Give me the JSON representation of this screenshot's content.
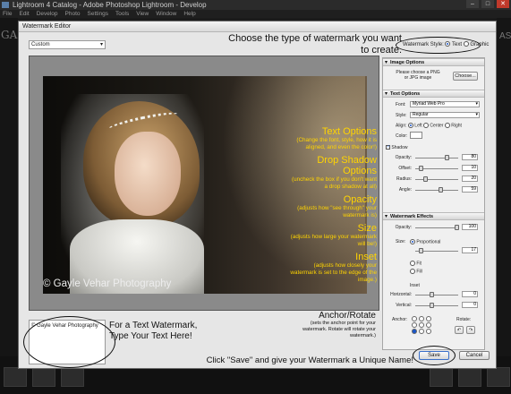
{
  "app": {
    "title": "Lightroom 4 Catalog - Adobe Photoshop Lightroom - Develop",
    "menu": [
      "File",
      "Edit",
      "Develop",
      "Photo",
      "Settings",
      "Tools",
      "View",
      "Window",
      "Help"
    ],
    "left_letters": "GA",
    "right_letters": "AS"
  },
  "dialog": {
    "title": "Watermark Editor",
    "preset": "Custom",
    "callout_style": "Choose the type of watermark you want to create.",
    "style_label": "Watermark Style:",
    "style_options": [
      "Text",
      "Graphic"
    ],
    "style_selected": "Text",
    "watermark_text": "© Gayle Vehar Photography",
    "text_area_value": "© Gayle Vehar Photography",
    "callout_text": "For a Text Watermark, Type Your Text Here!",
    "callout_save": "Click \"Save\" and give your Watermark a Unique Name!",
    "save_label": "Save",
    "cancel_label": "Cancel"
  },
  "annotations": [
    {
      "heading": "Text Options",
      "desc": "(Change the font, style, how it is aligned, and even the color!)"
    },
    {
      "heading": "Drop Shadow Options",
      "desc": "(uncheck the box if you don't want a drop shadow at all)"
    },
    {
      "heading": "Opacity",
      "desc": "(adjusts how \"see through\" your watermark is)"
    },
    {
      "heading": "Size",
      "desc": "(adjusts how large your watermark will be!)"
    },
    {
      "heading": "Inset",
      "desc": "(adjusts how closely your watermark is set to the edge of the image.)"
    },
    {
      "heading": "Anchor/Rotate",
      "desc": "(sets the anchor point for your watermark. Rotate will rotate your watermark.)"
    }
  ],
  "panel": {
    "image_options": {
      "title": "Image Options",
      "note": "Please choose a PNG or JPG image",
      "choose_label": "Choose..."
    },
    "text_options": {
      "title": "Text Options",
      "font_label": "Font:",
      "font_value": "Myriad Web Pro",
      "style_label": "Style:",
      "style_value": "Regular",
      "align_label": "Align:",
      "align_options": [
        "Left",
        "Center",
        "Right"
      ],
      "align_selected": "Left",
      "color_label": "Color:",
      "color_value": "#ffffff",
      "shadow_label": "Shadow",
      "shadow_checked": true,
      "opacity_label": "Opacity:",
      "opacity_value": "80",
      "offset_label": "Offset:",
      "offset_value": "10",
      "radius_label": "Radius:",
      "radius_value": "20",
      "angle_label": "Angle:",
      "angle_value": "59"
    },
    "watermark_effects": {
      "title": "Watermark Effects",
      "opacity_label": "Opacity:",
      "opacity_value": "100",
      "size_label": "Size:",
      "size_options": [
        "Proportional",
        "Fit",
        "Fill"
      ],
      "size_selected": "Proportional",
      "size_value": "17",
      "inset_label": "Inset",
      "horizontal_label": "Horizontal:",
      "horizontal_value": "0",
      "vertical_label": "Vertical:",
      "vertical_value": "0",
      "anchor_label": "Anchor:",
      "rotate_label": "Rotate:"
    }
  },
  "colors": {
    "annotation": "#ffd400",
    "accent": "#1a56c8"
  }
}
